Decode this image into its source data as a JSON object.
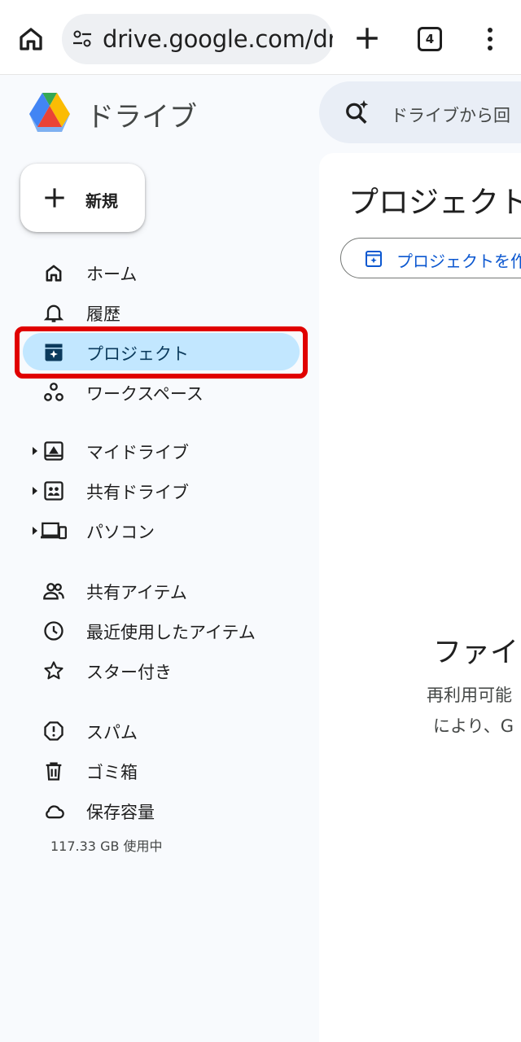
{
  "browser": {
    "url": "drive.google.com/driv",
    "tab_count": "4"
  },
  "app": {
    "brand": "ドライブ"
  },
  "new_button": {
    "label": "新規"
  },
  "nav": {
    "primary": [
      {
        "label": "ホーム",
        "icon": "home-icon"
      },
      {
        "label": "履歴",
        "icon": "bell-icon"
      },
      {
        "label": "プロジェクト",
        "icon": "project-icon",
        "active": true
      },
      {
        "label": "ワークスペース",
        "icon": "workspace-icon"
      }
    ],
    "drives": [
      {
        "label": "マイドライブ",
        "icon": "my-drive-icon"
      },
      {
        "label": "共有ドライブ",
        "icon": "shared-drive-icon"
      },
      {
        "label": "パソコン",
        "icon": "computer-icon"
      }
    ],
    "views": [
      {
        "label": "共有アイテム",
        "icon": "people-icon"
      },
      {
        "label": "最近使用したアイテム",
        "icon": "clock-icon"
      },
      {
        "label": "スター付き",
        "icon": "star-icon"
      }
    ],
    "other": [
      {
        "label": "スパム",
        "icon": "spam-icon"
      },
      {
        "label": "ゴミ箱",
        "icon": "trash-icon"
      },
      {
        "label": "保存容量",
        "icon": "cloud-icon"
      }
    ]
  },
  "storage_text": "117.33 GB 使用中",
  "search": {
    "placeholder": "ドライブから回"
  },
  "main": {
    "title": "プロジェクト",
    "create_chip": "プロジェクトを作",
    "empty_title": "ファイ",
    "empty_line1": "再利用可能",
    "empty_line2": "により、G"
  },
  "colors": {
    "active_bg": "#c2e7ff",
    "highlight": "#e00000",
    "accent": "#0b57d0"
  }
}
